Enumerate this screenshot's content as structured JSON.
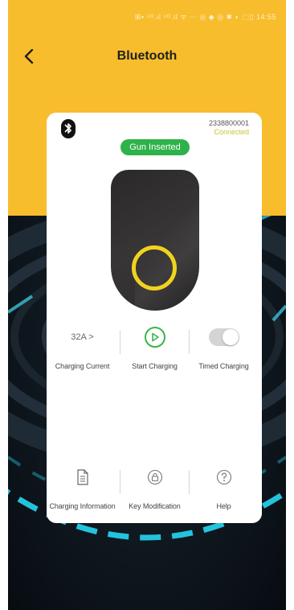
{
  "status_bar": {
    "text": "⊞▪ ⁴ᴳ.ıl ⁴ᴳ.ıl ᯤ ⋯ ◎ ◆   ◎ ✱ ◐ ⬚▯ 14:55"
  },
  "nav": {
    "title": "Bluetooth",
    "back_icon": "back-arrow-icon"
  },
  "device": {
    "id": "2338800001",
    "connection_status": "Connected",
    "gun_status": "Gun Inserted"
  },
  "controls": {
    "charging_current": {
      "value": "32A >",
      "label": "Charging Current"
    },
    "start_charging": {
      "label": "Start Charging",
      "icon": "play-icon"
    },
    "timed_charging": {
      "label": "Timed Charging",
      "state": "off",
      "icon": "toggle-switch"
    }
  },
  "bottom_actions": {
    "charging_information": {
      "label": "Charging Information",
      "icon": "document-icon"
    },
    "key_modification": {
      "label": "Key Modification",
      "icon": "lock-icon"
    },
    "help": {
      "label": "Help",
      "icon": "help-icon"
    }
  },
  "colors": {
    "header_yellow": "#f8bd2d",
    "badge_green": "#2eb24a",
    "connected_yellow": "#c8c23a",
    "ring_yellow": "#f0d31e",
    "start_green": "#3ab54a"
  }
}
